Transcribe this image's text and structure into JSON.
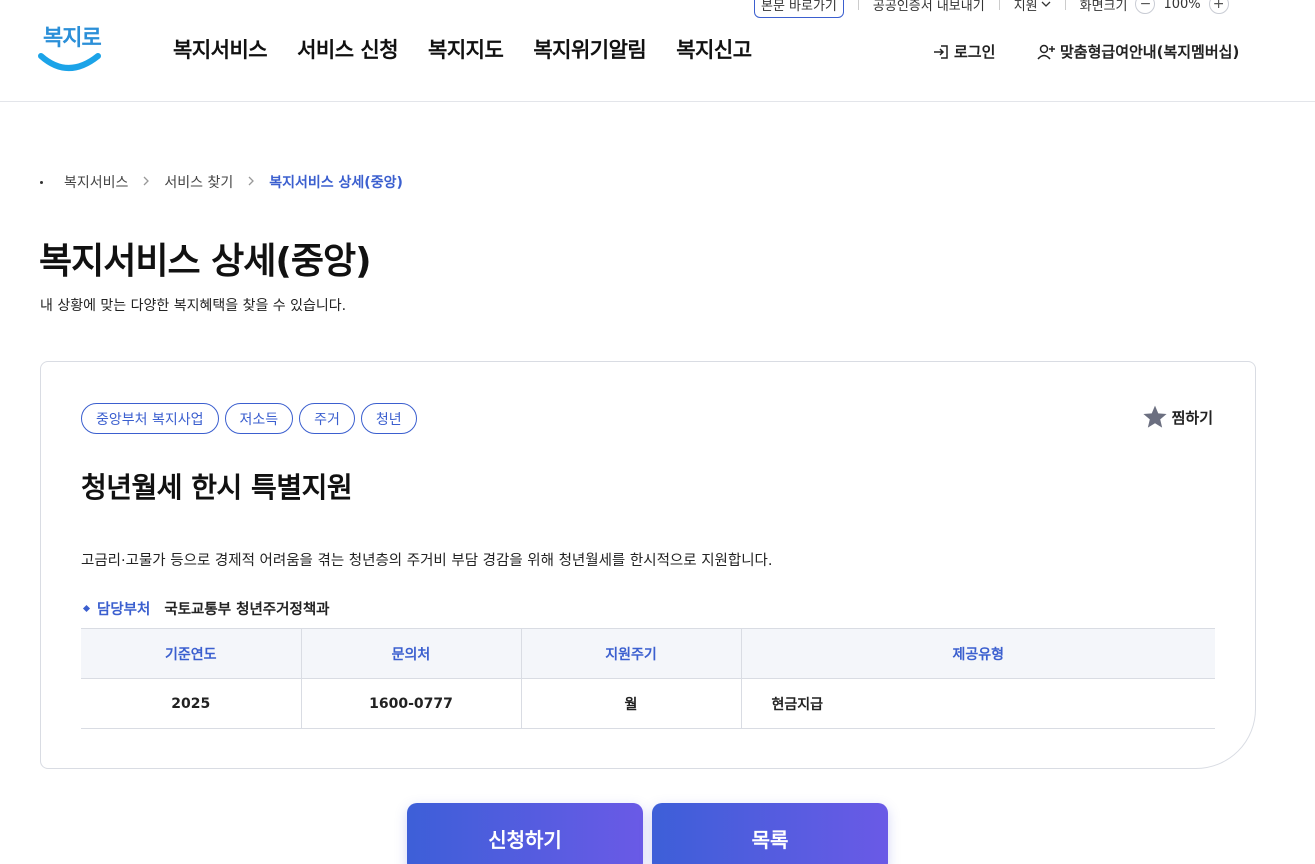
{
  "utility": {
    "skip_label": "본문 바로가기",
    "export_label": "공공인증서 내보내기",
    "language_label": "지원",
    "zoom_label": "화면크기",
    "zoom_value": "100%",
    "zoom_out": "−",
    "zoom_in": "+"
  },
  "logo": {
    "text": "복지로"
  },
  "gnb": {
    "items": [
      "복지서비스",
      "서비스 신청",
      "복지지도",
      "복지위기알림",
      "복지신고"
    ]
  },
  "account": {
    "login_label": "로그인",
    "membership_label": "맞춤형급여안내(복지멤버십)"
  },
  "breadcrumb": {
    "items": [
      "복지서비스",
      "서비스 찾기"
    ],
    "current": "복지서비스 상세(중앙)"
  },
  "page": {
    "title": "복지서비스 상세(중앙)",
    "description": "내 상황에 맞는 다양한 복지혜택을 찾을 수 있습니다."
  },
  "service": {
    "tags": [
      "중앙부처 복지사업",
      "저소득",
      "주거",
      "청년"
    ],
    "favorite_label": "찜하기",
    "title": "청년월세 한시 특별지원",
    "description": "고금리·고물가 등으로 경제적 어려움을 겪는 청년층의 주거비 부담 경감을 위해 청년월세를 한시적으로 지원합니다.",
    "department_label": "담당부처",
    "department_value": "국토교통부 청년주거정책과",
    "table": {
      "headers": [
        "기준연도",
        "문의처",
        "지원주기",
        "제공유형"
      ],
      "row": [
        "2025",
        "1600-0777",
        "월",
        "현금지급"
      ]
    }
  },
  "actions": {
    "apply_label": "신청하기",
    "list_label": "목록"
  },
  "colors": {
    "accent": "#3b5fcf",
    "button_gradient_start": "#3d5fd8",
    "button_gradient_end": "#6a5ae6"
  }
}
